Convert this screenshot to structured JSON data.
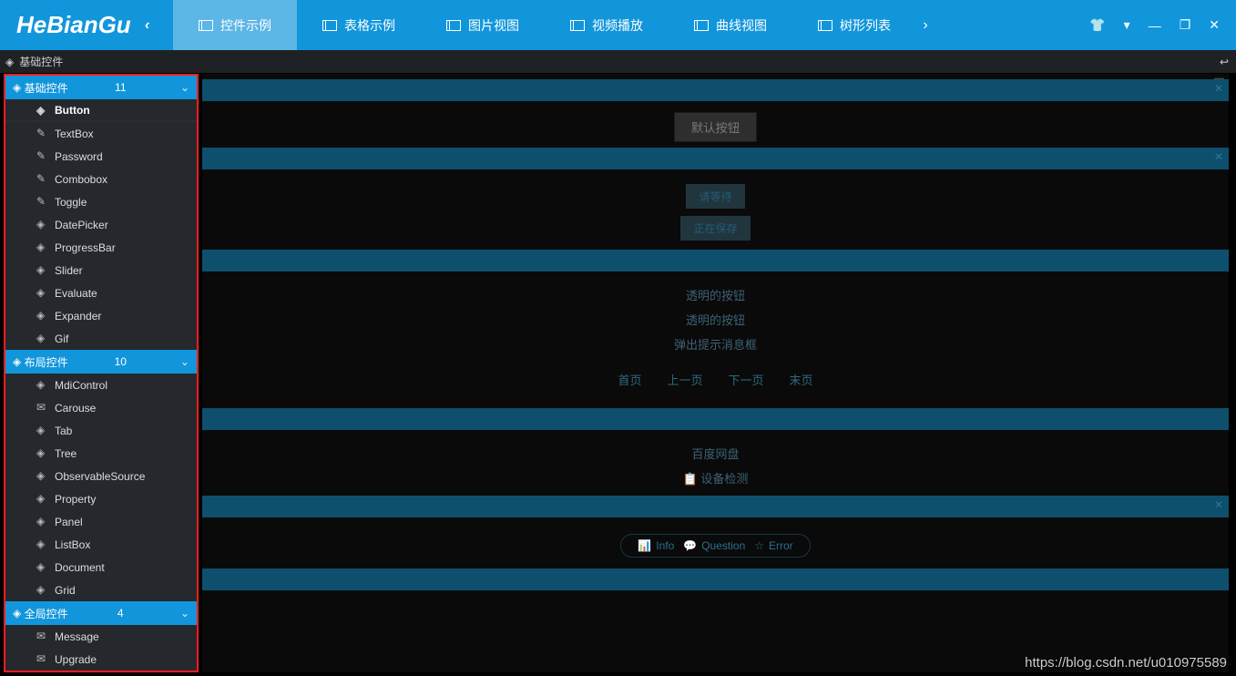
{
  "logo_text": "HeBianGu",
  "nav": {
    "items": [
      {
        "label": "控件示例"
      },
      {
        "label": "表格示例"
      },
      {
        "label": "图片视图"
      },
      {
        "label": "视频播放"
      },
      {
        "label": "曲线视图"
      },
      {
        "label": "树形列表"
      }
    ]
  },
  "breadcrumb": {
    "label": "基础控件"
  },
  "sidebar": {
    "groups": [
      {
        "title": "基础控件",
        "count": "11",
        "items": [
          "Button",
          "TextBox",
          "Password",
          "Combobox",
          "Toggle",
          "DatePicker",
          "ProgressBar",
          "Slider",
          "Evaluate",
          "Expander",
          "Gif"
        ]
      },
      {
        "title": "布局控件",
        "count": "10",
        "items": [
          "MdiControl",
          "Carouse",
          "Tab",
          "Tree",
          "ObservableSource",
          "Property",
          "Panel",
          "ListBox",
          "Document",
          "Grid"
        ]
      },
      {
        "title": "全局控件",
        "count": "4",
        "items": [
          "Message",
          "Upgrade"
        ]
      }
    ]
  },
  "main": {
    "default_button": "默认按钮",
    "wait_button": "请等待",
    "saving_button": "正在保存",
    "t1": "透明的按钮",
    "t2": "透明的按钮",
    "t3": "弹出提示消息框",
    "pager": {
      "first": "首页",
      "prev": "上一页",
      "next": "下一页",
      "last": "末页"
    },
    "link1": "百度网盘",
    "link2": "设备检测",
    "pills": {
      "info": "Info",
      "question": "Question",
      "error": "Error"
    }
  },
  "watermark": "https://blog.csdn.net/u010975589"
}
